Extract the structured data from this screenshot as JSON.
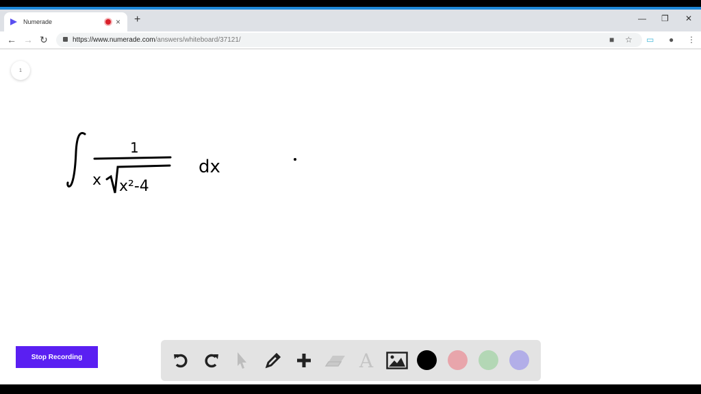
{
  "browser": {
    "tab_title": "Numerade",
    "url_host": "https://www.numerade.com",
    "url_path": "/answers/whiteboard/37121/",
    "new_tab_label": "+"
  },
  "whiteboard": {
    "page_number": "1",
    "expression": {
      "numerator": "1",
      "denominator_x": "x",
      "radicand": "x²-4",
      "differential": "dx"
    }
  },
  "recording": {
    "stop_label": "Stop Recording"
  },
  "toolbar": {
    "tools": [
      "undo-icon",
      "redo-icon",
      "pointer-icon",
      "pencil-icon",
      "add-icon",
      "eraser-icon",
      "text-icon",
      "image-icon"
    ],
    "colors": [
      "#000000",
      "#e8a5ab",
      "#b3d7b5",
      "#b2aee8"
    ]
  }
}
